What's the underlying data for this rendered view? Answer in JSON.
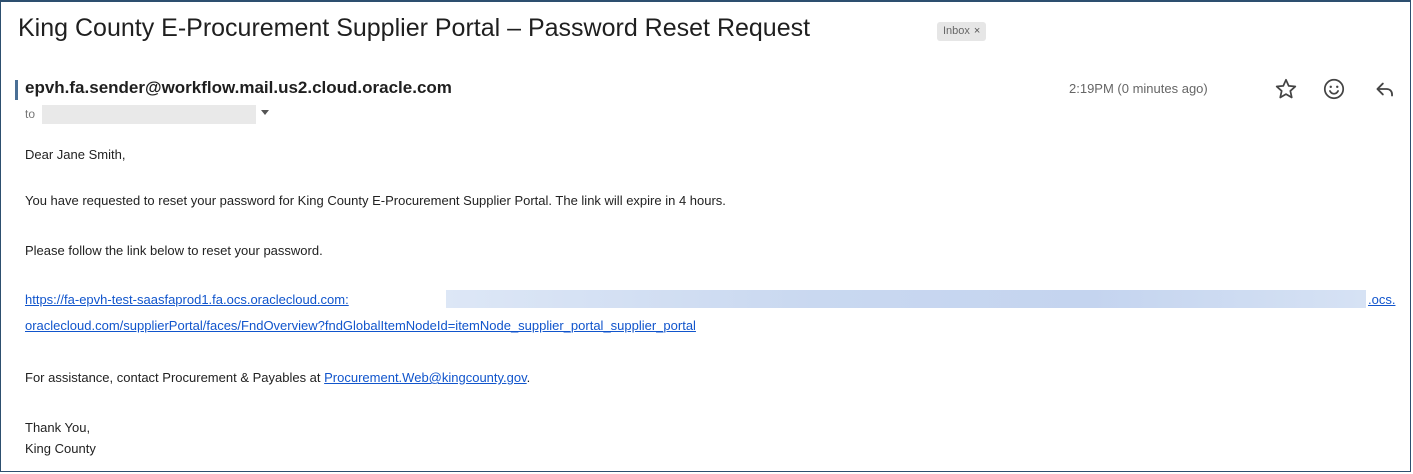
{
  "email": {
    "subject": "King County E-Procurement Supplier Portal – Password Reset Request",
    "label_badge": "Inbox",
    "label_badge_close": "×",
    "sender": "epvh.fa.sender@workflow.mail.us2.cloud.oracle.com",
    "to_label": "to",
    "time": "2:19PM (0 minutes ago)",
    "icons": {
      "star": "star-icon",
      "emoji": "emoji-reaction-icon",
      "reply": "reply-icon"
    },
    "body": {
      "greeting": "Dear Jane Smith,",
      "paragraph1": "You have requested to reset your password for King County E-Procurement Supplier Portal. The link will expire in 4 hours.",
      "paragraph2": "Please follow the link below to reset your password.",
      "link_line1_start": "https://fa-epvh-test-saasfaprod1.fa.ocs.oraclecloud.com:",
      "link_line1_end": ".ocs.",
      "link_line2": "oraclecloud.com/supplierPortal/faces/FndOverview?fndGlobalItemNodeId=itemNode_supplier_portal_supplier_portal",
      "assist_prefix": "For assistance, contact Procurement & Payables at ",
      "assist_email": "Procurement.Web@kingcounty.gov",
      "assist_suffix": ".",
      "closing": "Thank You,",
      "signature": "King County"
    }
  }
}
